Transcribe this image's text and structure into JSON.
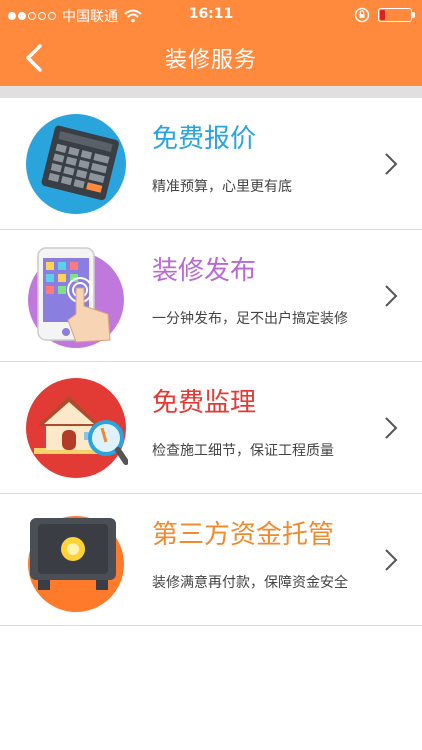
{
  "status_bar": {
    "carrier": "中国联通",
    "time": "16:11"
  },
  "nav": {
    "title": "装修服务"
  },
  "colors": {
    "brand_orange": "#ff8a3d",
    "title_blue": "#29a4dc",
    "title_purple": "#b86ad2",
    "title_red": "#e23a35",
    "title_orange": "#f08a2c"
  },
  "services": [
    {
      "title": "免费报价",
      "subtitle": "精准预算，心里更有底",
      "icon": "calculator-icon",
      "color": "#29a4dc"
    },
    {
      "title": "装修发布",
      "subtitle": "一分钟发布，足不出户搞定装修",
      "icon": "phone-tap-icon",
      "color": "#b86ad2"
    },
    {
      "title": "免费监理",
      "subtitle": "检查施工细节，保证工程质量",
      "icon": "house-inspect-icon",
      "color": "#e23a35"
    },
    {
      "title": "第三方资金托管",
      "subtitle": "装修满意再付款，保障资金安全",
      "icon": "safe-icon",
      "color": "#f08a2c"
    }
  ]
}
